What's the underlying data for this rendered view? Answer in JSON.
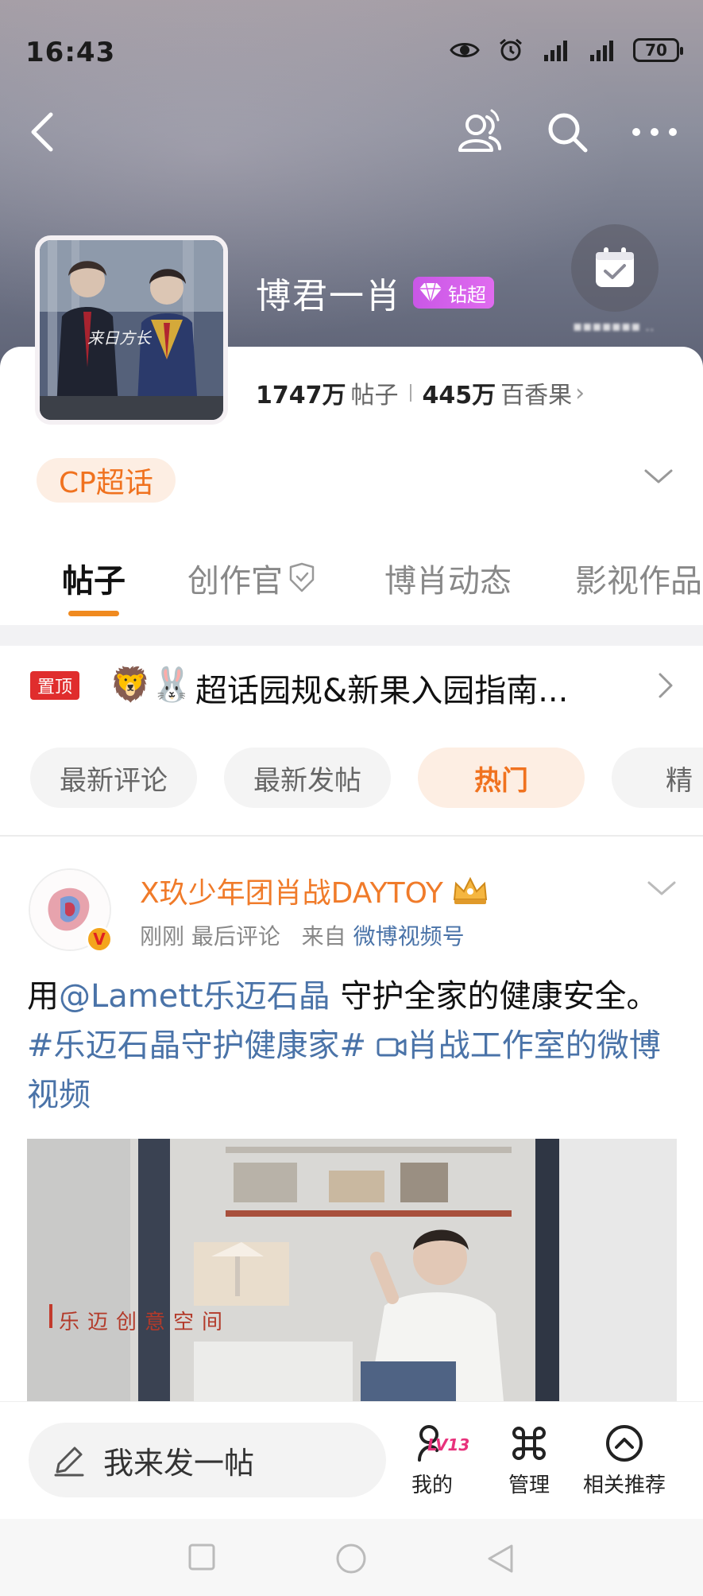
{
  "status_bar": {
    "time": "16:43",
    "battery": "70",
    "icons": [
      "eye-icon",
      "alarm-icon",
      "signal-icon",
      "signal-icon",
      "battery-icon"
    ]
  },
  "nav": {
    "back_icon": "chevron-left-icon",
    "icons": [
      "community-icon",
      "search-icon",
      "more-icon"
    ]
  },
  "topic": {
    "title": "博君一肖",
    "badge": "钻超",
    "posts_count": "1747万",
    "posts_label": "帖子",
    "fans_count": "445万",
    "fans_label": "百香果",
    "category_tag": "CP超话",
    "checkin_icon": "calendar-check-icon"
  },
  "tabs": [
    {
      "label": "帖子",
      "active": true
    },
    {
      "label": "创作官",
      "active": false
    },
    {
      "label": "博肖动态",
      "active": false
    },
    {
      "label": "影视作品",
      "active": false
    }
  ],
  "pinned": {
    "tag": "置顶",
    "emoji": "🦁🐰",
    "text": "超话园规&新果入园指南..."
  },
  "filters": [
    {
      "label": "最新评论",
      "active": false
    },
    {
      "label": "最新发帖",
      "active": false
    },
    {
      "label": "热门",
      "active": true
    },
    {
      "label": "精",
      "active": false
    }
  ],
  "post": {
    "author": "X玖少年团肖战DAYTOY",
    "verified_mark": "V",
    "time": "刚刚",
    "meta_label": "最后评论",
    "from_label": "来自",
    "source": "微博视频号",
    "text_prefix": "用",
    "mention": "@Lamett乐迈石晶",
    "text_mid": " 守护全家的健康安全。",
    "hashtag": "#乐迈石晶守护健康家#",
    "video_link": "肖战工作室的微博视频",
    "media_caption": "乐迈创意空间"
  },
  "bottom_bar": {
    "compose_placeholder": "我来发一帖",
    "level": "LV13",
    "mine": "我的",
    "manage": "管理",
    "related": "相关推荐"
  },
  "colors": {
    "accent": "#f0721f",
    "link": "#4a73a8",
    "pin_red": "#e02d2d",
    "badge_purple": "#d45fea"
  }
}
